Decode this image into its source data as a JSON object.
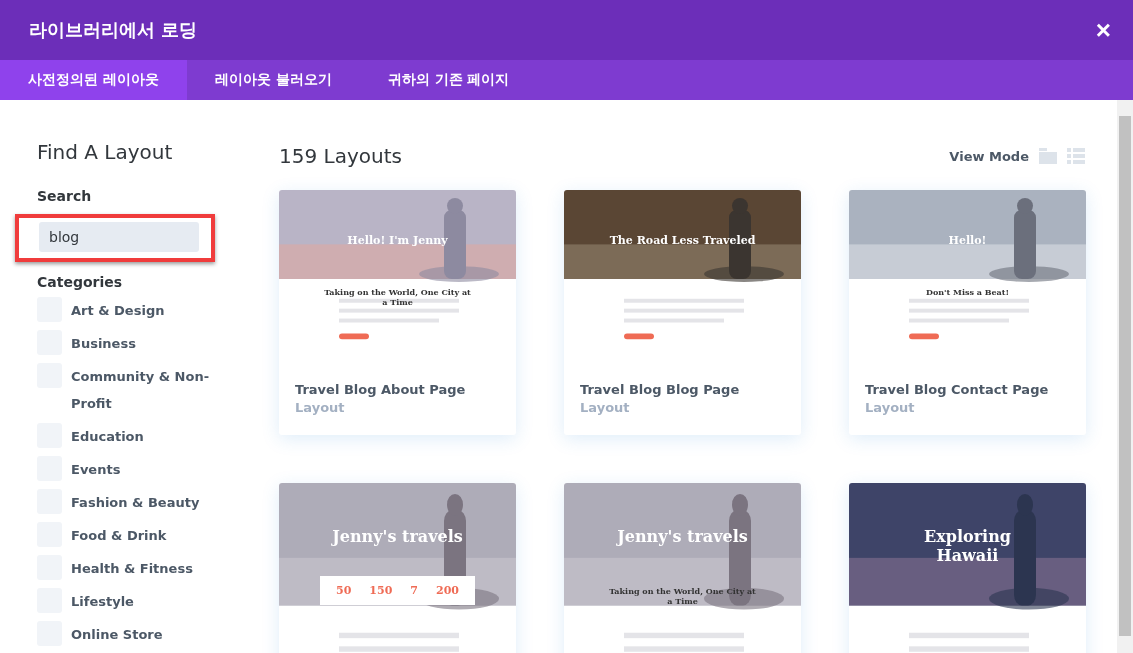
{
  "window": {
    "title": "라이브러리에서 로딩",
    "close": "×"
  },
  "tabs": [
    {
      "label": "사전정의된 레이아웃",
      "selected": true
    },
    {
      "label": "레이아웃 불러오기",
      "selected": false
    },
    {
      "label": "귀하의 기존 페이지",
      "selected": false
    }
  ],
  "sidebar": {
    "heading": "Find A Layout",
    "search_label": "Search",
    "search": {
      "value": "blog",
      "highlighted": true
    },
    "categories_label": "Categories",
    "categories": [
      {
        "label": "Art & Design",
        "checked": false
      },
      {
        "label": "Business",
        "checked": false
      },
      {
        "label": "Community & Non-Profit",
        "checked": false
      },
      {
        "label": "Education",
        "checked": false
      },
      {
        "label": "Events",
        "checked": false
      },
      {
        "label": "Fashion & Beauty",
        "checked": false
      },
      {
        "label": "Food & Drink",
        "checked": false
      },
      {
        "label": "Health & Fitness",
        "checked": false
      },
      {
        "label": "Lifestyle",
        "checked": false
      },
      {
        "label": "Online Store",
        "checked": false
      }
    ]
  },
  "main": {
    "count": "159 Layouts",
    "view_mode": "View Mode",
    "layouts": [
      {
        "name": "Travel Blog About Page",
        "type": "Layout",
        "preview": {
          "headings": [
            "Hello! I'm Jenny",
            "Taking on the World, One City at a Time"
          ]
        }
      },
      {
        "name": "Travel Blog Blog Page",
        "type": "Layout",
        "preview": {
          "headings": [
            "The Road Less Traveled"
          ]
        }
      },
      {
        "name": "Travel Blog Contact Page",
        "type": "Layout",
        "preview": {
          "headings": [
            "Hello!",
            "Don't Miss a Beat!"
          ]
        }
      },
      {
        "preview": {
          "headings": [
            "Jenny's travels"
          ],
          "stats": [
            "50",
            "150",
            "7",
            "200"
          ]
        }
      },
      {
        "preview": {
          "headings": [
            "Jenny's travels",
            "Taking on the World, One City at a Time"
          ]
        }
      },
      {
        "preview": {
          "headings": [
            "Exploring Hawaii"
          ]
        }
      }
    ]
  }
}
